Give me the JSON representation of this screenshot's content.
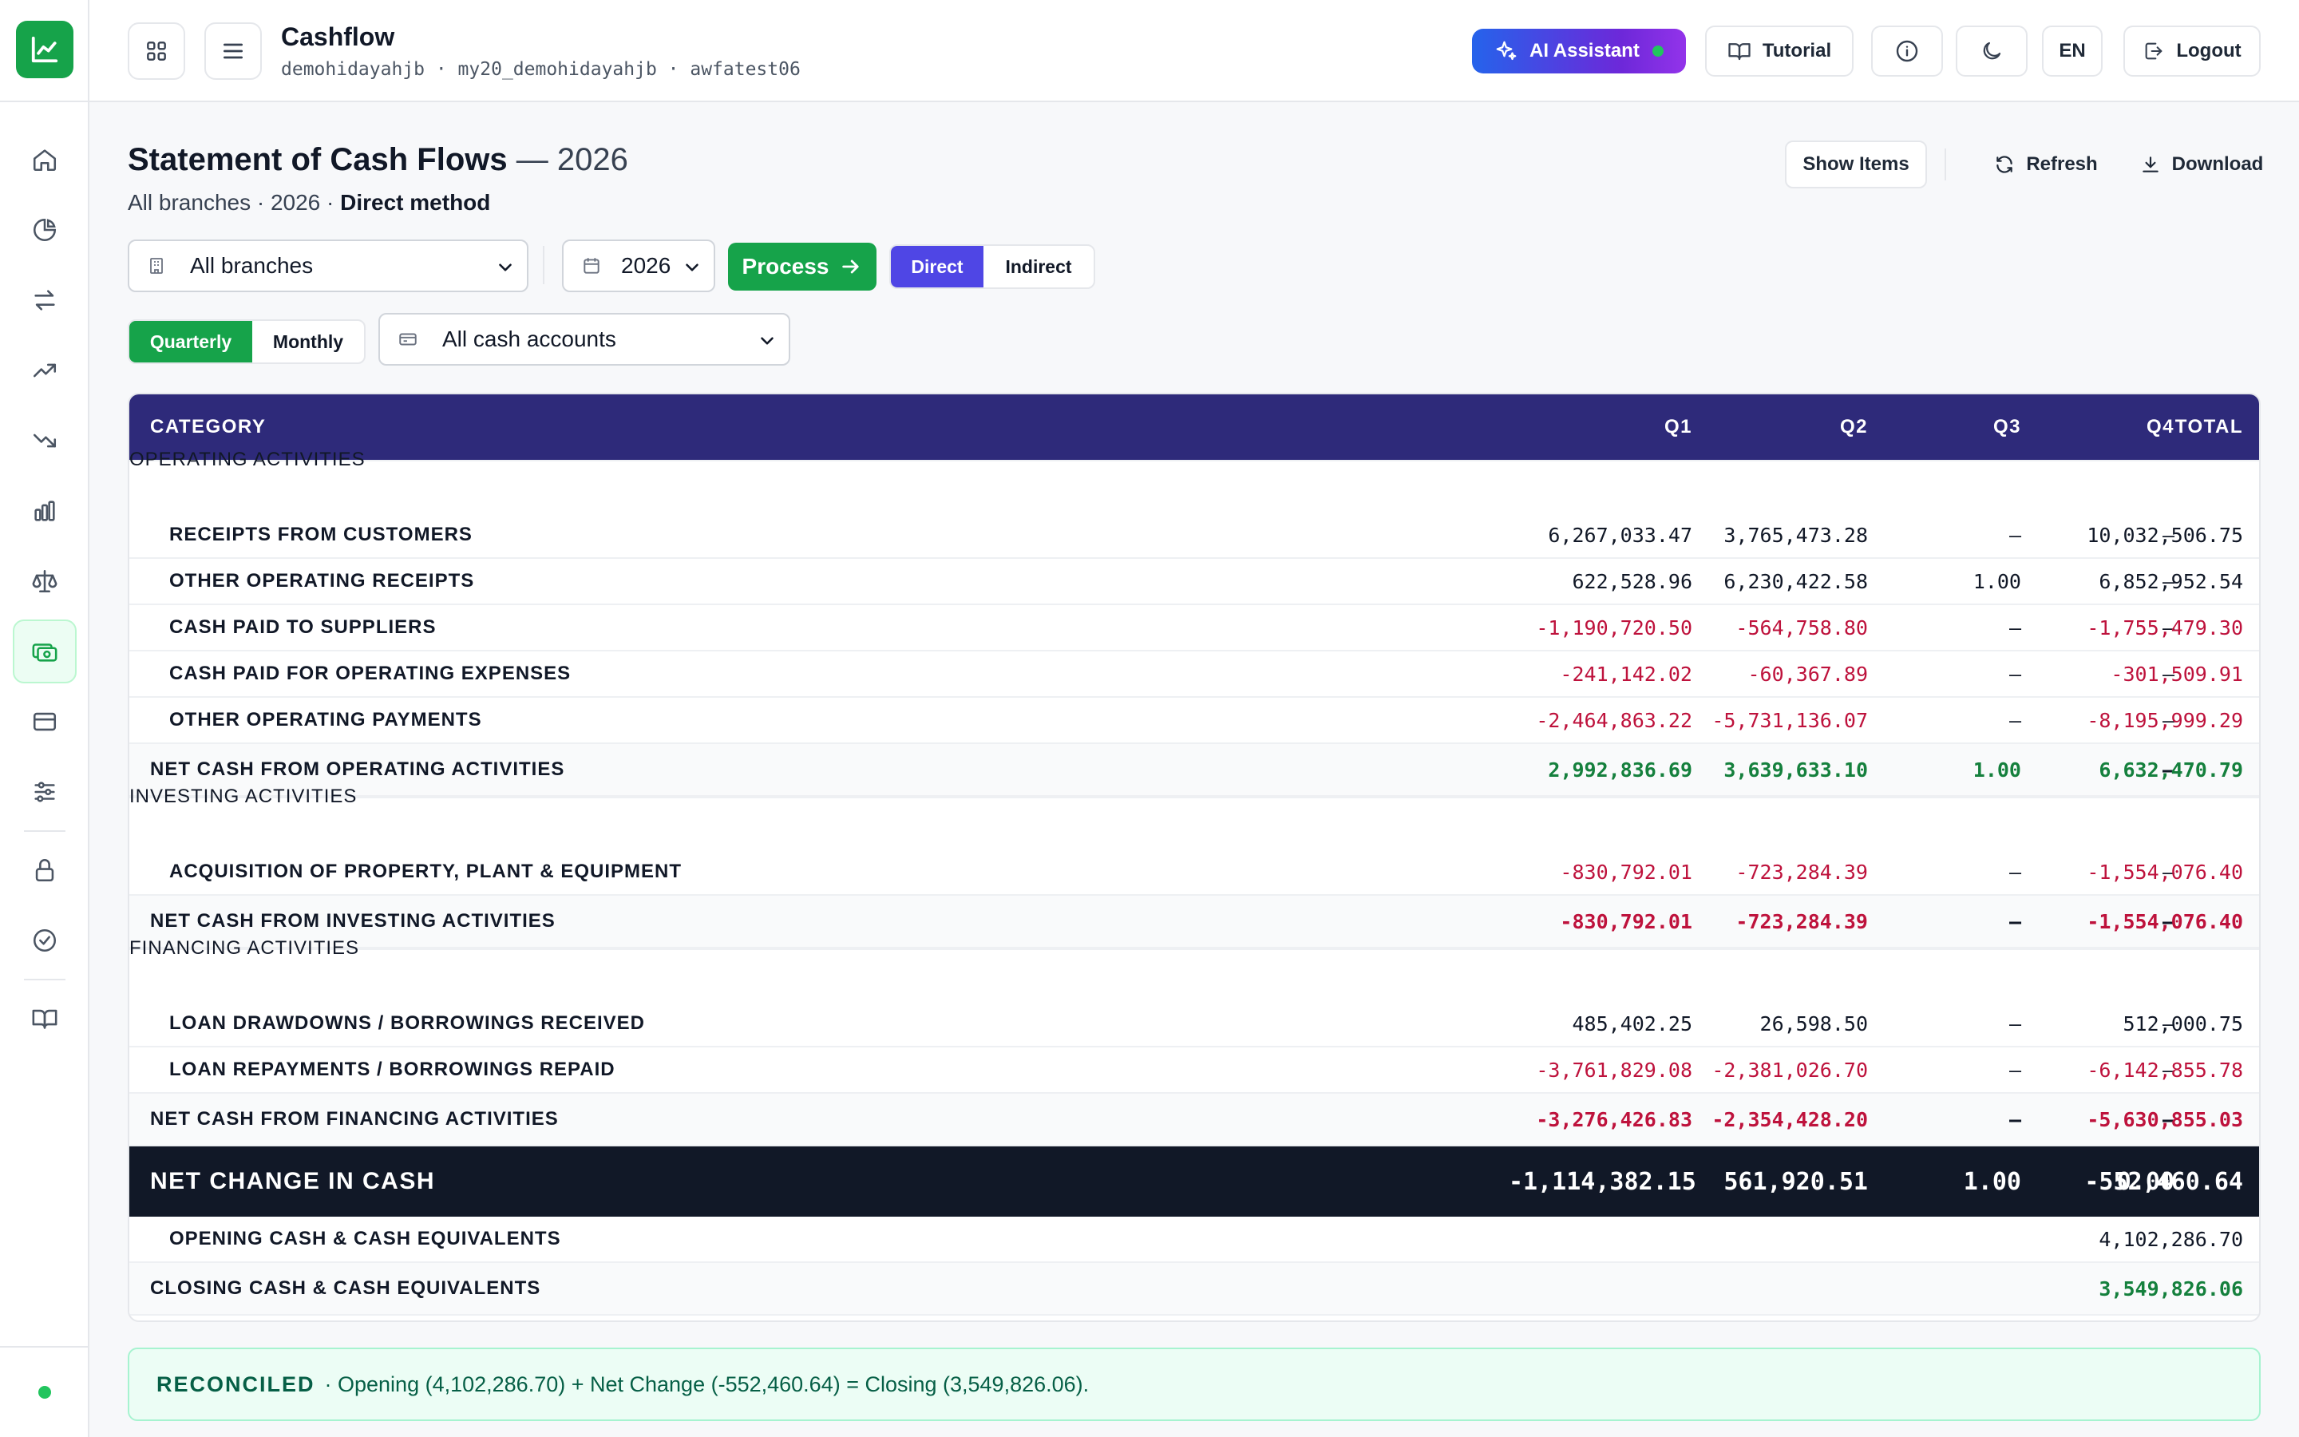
{
  "app": {
    "title": "Cashflow",
    "crumbs": "demohidayahjb · my20_demohidayahjb · awfatest06"
  },
  "topbar": {
    "ai_label": "AI Assistant",
    "tutorial_label": "Tutorial",
    "lang_label": "EN",
    "logout_label": "Logout"
  },
  "page": {
    "title": "Statement of Cash Flows",
    "year_suffix": "— 2026",
    "subtitle_prefix": "All branches · 2026 ·",
    "subtitle_method": "Direct method",
    "show_items_label": "Show Items",
    "refresh_label": "Refresh",
    "download_label": "Download"
  },
  "filters": {
    "branch": "All branches",
    "year": "2026",
    "process_label": "Process",
    "method_options": [
      "Direct",
      "Indirect"
    ],
    "method_selected": "Direct",
    "period_options": [
      "Quarterly",
      "Monthly"
    ],
    "period_selected": "Quarterly",
    "account": "All cash accounts"
  },
  "table": {
    "columns": [
      "CATEGORY",
      "Q1",
      "Q2",
      "Q3",
      "Q4",
      "TOTAL"
    ],
    "rows": [
      {
        "type": "section",
        "label": "OPERATING ACTIVITIES",
        "values": [
          "",
          "",
          "",
          "",
          ""
        ]
      },
      {
        "type": "item",
        "label": "RECEIPTS FROM CUSTOMERS",
        "values": [
          "6,267,033.47",
          "3,765,473.28",
          "–",
          "–",
          "10,032,506.75"
        ]
      },
      {
        "type": "item",
        "label": "OTHER OPERATING RECEIPTS",
        "values": [
          "622,528.96",
          "6,230,422.58",
          "1.00",
          "–",
          "6,852,952.54"
        ]
      },
      {
        "type": "item",
        "label": "CASH PAID TO SUPPLIERS",
        "values": [
          "-1,190,720.50",
          "-564,758.80",
          "–",
          "–",
          "-1,755,479.30"
        ]
      },
      {
        "type": "item",
        "label": "CASH PAID FOR OPERATING EXPENSES",
        "values": [
          "-241,142.02",
          "-60,367.89",
          "–",
          "–",
          "-301,509.91"
        ]
      },
      {
        "type": "item",
        "label": "OTHER OPERATING PAYMENTS",
        "values": [
          "-2,464,863.22",
          "-5,731,136.07",
          "–",
          "–",
          "-8,195,999.29"
        ]
      },
      {
        "type": "total",
        "label": "NET CASH FROM OPERATING ACTIVITIES",
        "values": [
          "2,992,836.69",
          "3,639,633.10",
          "1.00",
          "–",
          "6,632,470.79"
        ]
      },
      {
        "type": "section",
        "label": "INVESTING ACTIVITIES",
        "values": [
          "",
          "",
          "",
          "",
          ""
        ]
      },
      {
        "type": "item",
        "label": "ACQUISITION OF PROPERTY, PLANT & EQUIPMENT",
        "values": [
          "-830,792.01",
          "-723,284.39",
          "–",
          "–",
          "-1,554,076.40"
        ]
      },
      {
        "type": "total",
        "label": "NET CASH FROM INVESTING ACTIVITIES",
        "values": [
          "-830,792.01",
          "-723,284.39",
          "–",
          "–",
          "-1,554,076.40"
        ]
      },
      {
        "type": "section",
        "label": "FINANCING ACTIVITIES",
        "values": [
          "",
          "",
          "",
          "",
          ""
        ]
      },
      {
        "type": "item",
        "label": "LOAN DRAWDOWNS / BORROWINGS RECEIVED",
        "values": [
          "485,402.25",
          "26,598.50",
          "–",
          "–",
          "512,000.75"
        ]
      },
      {
        "type": "item",
        "label": "LOAN REPAYMENTS / BORROWINGS REPAID",
        "values": [
          "-3,761,829.08",
          "-2,381,026.70",
          "–",
          "–",
          "-6,142,855.78"
        ]
      },
      {
        "type": "total",
        "label": "NET CASH FROM FINANCING ACTIVITIES",
        "values": [
          "-3,276,426.83",
          "-2,354,428.20",
          "–",
          "–",
          "-5,630,855.03"
        ]
      },
      {
        "type": "net",
        "label": "NET CHANGE IN CASH",
        "values": [
          "-1,114,382.15",
          "561,920.51",
          "1.00",
          "0.00",
          "-552,460.64"
        ]
      },
      {
        "type": "item",
        "label": "OPENING CASH & CASH EQUIVALENTS",
        "values": [
          "",
          "",
          "",
          "",
          "4,102,286.70"
        ]
      },
      {
        "type": "total",
        "label": "CLOSING CASH & CASH EQUIVALENTS",
        "values": [
          "",
          "",
          "",
          "",
          "3,549,826.06"
        ]
      }
    ]
  },
  "reconciliation": {
    "status": "RECONCILED",
    "text": "· Opening (4,102,286.70) + Net Change (-552,460.64) = Closing (3,549,826.06)."
  },
  "colors": {
    "brand_green": "#16a34a",
    "header_navy": "#2e2a7a",
    "negative": "#be123c",
    "positive": "#15803d",
    "method_active": "#4f46e5"
  },
  "icons": {
    "sidebar": [
      "home-icon",
      "pie-chart-icon",
      "transfer-icon",
      "trending-up-icon",
      "trending-down-icon",
      "bar-chart-icon",
      "scale-icon",
      "cash-icon",
      "card-icon",
      "sliders-icon",
      "lock-icon",
      "check-circle-icon",
      "book-icon"
    ]
  }
}
